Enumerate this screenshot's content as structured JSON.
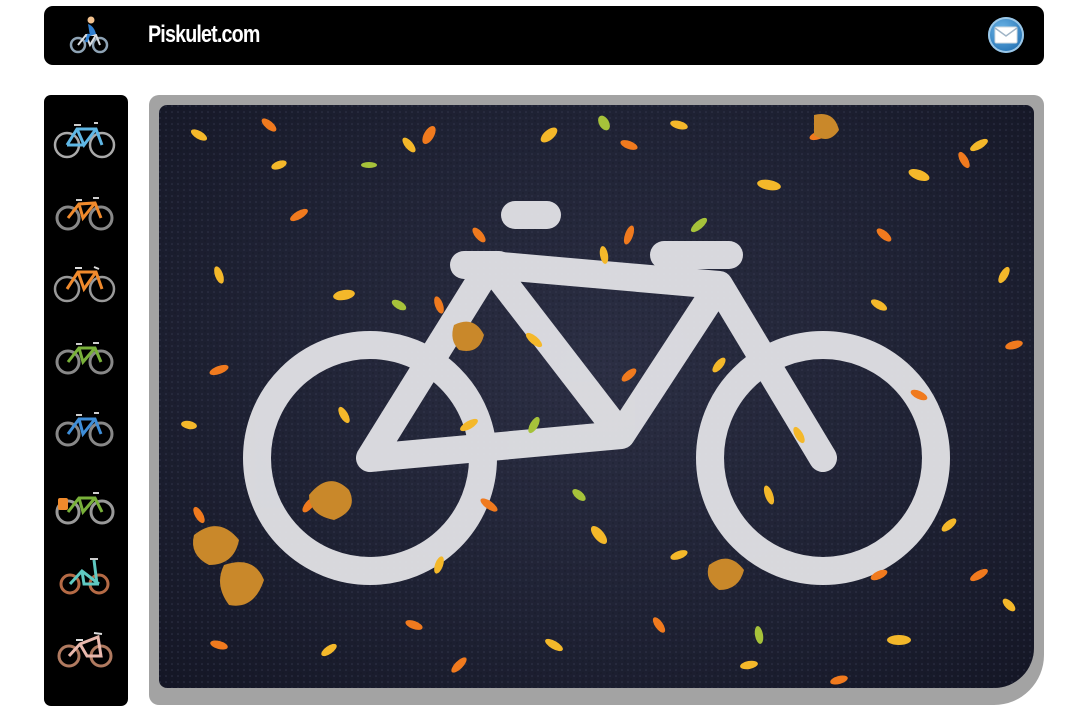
{
  "header": {
    "site_title": "Piskulet.com",
    "logo_icon": "cyclist-icon",
    "mail_icon": "envelope-icon"
  },
  "sidebar": {
    "items": [
      {
        "icon": "road-bike-icon",
        "color": "#5fb7e5"
      },
      {
        "icon": "mountain-bike-icon",
        "color": "#f08a2c"
      },
      {
        "icon": "road-bike-icon",
        "color": "#f08a2c"
      },
      {
        "icon": "hybrid-bike-icon",
        "color": "#79b13a"
      },
      {
        "icon": "city-bike-icon",
        "color": "#3f8ed8"
      },
      {
        "icon": "touring-bike-icon",
        "color": "#79b13a"
      },
      {
        "icon": "folding-bike-icon",
        "color": "#5fc9c2"
      },
      {
        "icon": "cruiser-bike-icon",
        "color": "#e8b8ad"
      }
    ]
  },
  "main": {
    "image_icon": "bike-lane-marking-photo"
  },
  "colors": {
    "header_bg": "#000000",
    "frame": "#a3a3a3",
    "asphalt": "#1f2234",
    "paint": "#e6e6ea",
    "leaf_yellow": "#f4b82a",
    "leaf_orange": "#f07a1e"
  }
}
